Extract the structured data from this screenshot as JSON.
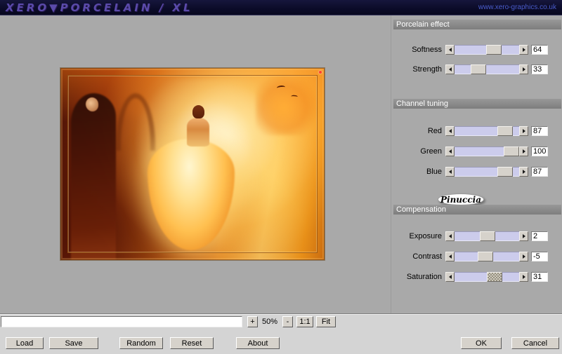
{
  "header": {
    "logo": "XERO▼PORCELAIN / XL",
    "url": "www.xero-graphics.co.uk"
  },
  "panels": [
    {
      "title": "Porcelain effect",
      "sliders": [
        {
          "label": "Softness",
          "value": 64,
          "min": 0,
          "max": 100
        },
        {
          "label": "Strength",
          "value": 33,
          "min": 0,
          "max": 100
        }
      ]
    },
    {
      "title": "Channel tuning",
      "sliders": [
        {
          "label": "Red",
          "value": 87,
          "min": 0,
          "max": 100
        },
        {
          "label": "Green",
          "value": 100,
          "min": 0,
          "max": 100
        },
        {
          "label": "Blue",
          "value": 87,
          "min": 0,
          "max": 100
        }
      ]
    },
    {
      "title": "Compensation",
      "sliders": [
        {
          "label": "Exposure",
          "value": 2,
          "min": -100,
          "max": 100
        },
        {
          "label": "Contrast",
          "value": -5,
          "min": -100,
          "max": 100
        },
        {
          "label": "Saturation",
          "value": 31,
          "min": -100,
          "max": 100,
          "active": true
        }
      ]
    }
  ],
  "badge": {
    "text": "Pinuccia"
  },
  "statusbar": {
    "path_value": "",
    "zoom_in": "+",
    "zoom_level": "50%",
    "zoom_out": "-",
    "zoom_actual": "1:1",
    "zoom_fit": "Fit"
  },
  "buttons": {
    "load": "Load",
    "save": "Save",
    "random": "Random",
    "reset": "Reset",
    "about": "About",
    "ok": "OK",
    "cancel": "Cancel"
  },
  "colors": {
    "header_bg": "#0b0b28",
    "logo": "#5a4aaa",
    "url": "#4a5ccc",
    "panel_bg": "#a9a9a9",
    "slider_track": "#ccccec",
    "button_face": "#d6d2cb"
  }
}
